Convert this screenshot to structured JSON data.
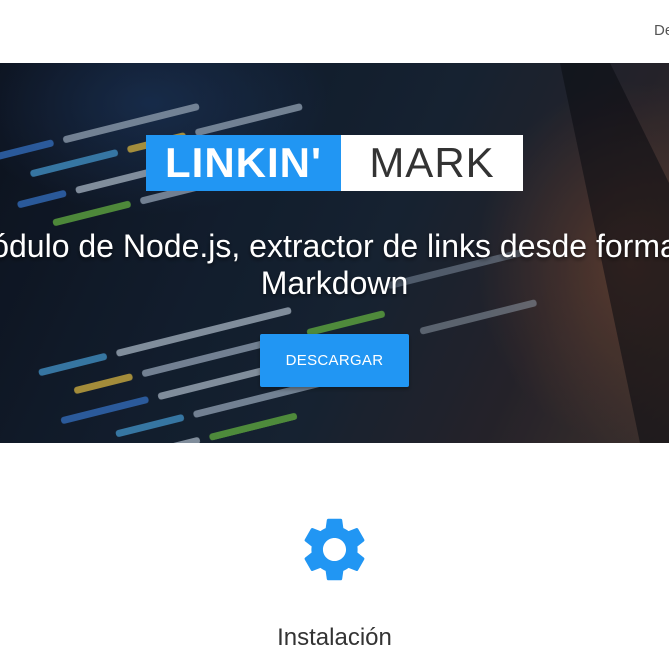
{
  "nav": {
    "link_label": "De"
  },
  "hero": {
    "logo_left": "LINKIN'",
    "logo_right": "MARK",
    "tagline_line1": "Módulo de Node.js, extractor de links desde formato",
    "tagline_line2": "Markdown",
    "download_label": "DESCARGAR"
  },
  "feature": {
    "icon": "gear-icon",
    "title": "Instalación"
  },
  "colors": {
    "accent": "#2196f3",
    "text_dark": "#333333",
    "nav_text": "#555555"
  }
}
